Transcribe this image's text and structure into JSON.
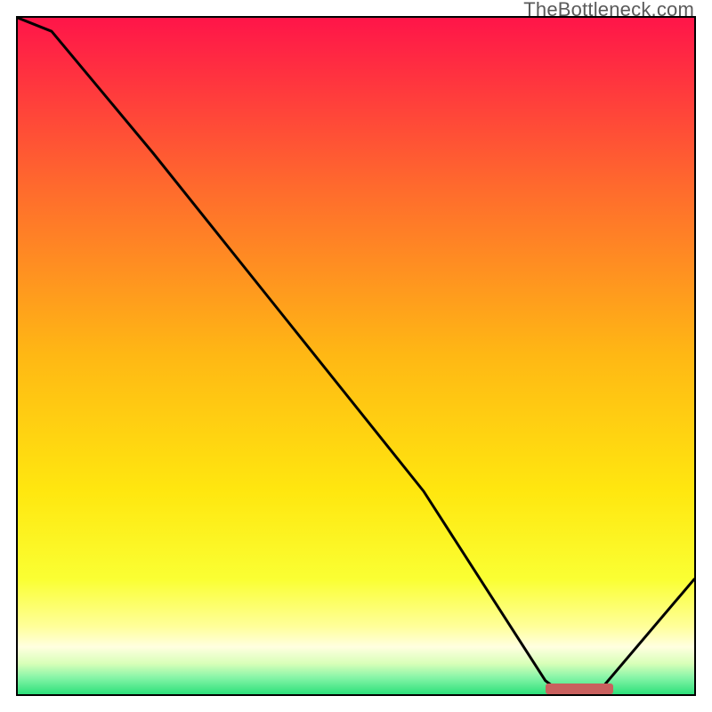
{
  "watermark": "TheBottleneck.com",
  "chart_data": {
    "type": "line",
    "title": "",
    "xlabel": "",
    "ylabel": "",
    "xlim": [
      0,
      100
    ],
    "ylim": [
      0,
      100
    ],
    "x": [
      0,
      5,
      20,
      40,
      60,
      78,
      80,
      86,
      100
    ],
    "values": [
      100,
      98,
      80,
      55,
      30,
      2,
      0.5,
      0.5,
      17
    ],
    "gradient_stops": [
      {
        "offset": 0.0,
        "color": "#ff1549"
      },
      {
        "offset": 0.25,
        "color": "#ff6a2d"
      },
      {
        "offset": 0.5,
        "color": "#ffb814"
      },
      {
        "offset": 0.7,
        "color": "#ffe70f"
      },
      {
        "offset": 0.83,
        "color": "#faff33"
      },
      {
        "offset": 0.9,
        "color": "#ffff9a"
      },
      {
        "offset": 0.93,
        "color": "#ffffe0"
      },
      {
        "offset": 0.955,
        "color": "#d8ffb8"
      },
      {
        "offset": 0.975,
        "color": "#88f5a8"
      },
      {
        "offset": 1.0,
        "color": "#2de07a"
      }
    ],
    "valley_bar": {
      "x_start": 78,
      "x_end": 88,
      "color": "#c9605e"
    }
  }
}
